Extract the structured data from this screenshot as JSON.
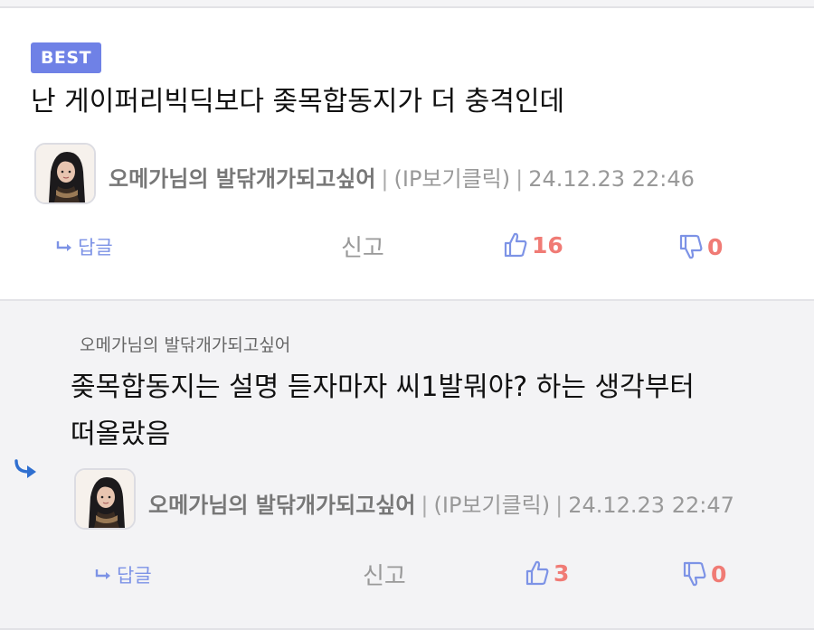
{
  "best_comment": {
    "badge": "BEST",
    "text": "난 게이퍼리빅딕보다 좆목합동지가 더 충격인데",
    "author": "오메가님의 발닦개가되고싶어",
    "ip_label": "(IP보기클릭)",
    "timestamp": "24.12.23 22:46",
    "reply_label": "답글",
    "report_label": "신고",
    "likes": "16",
    "dislikes": "0"
  },
  "reply_comment": {
    "reply_to": "오메가님의 발닦개가되고싶어",
    "text_line1": "좆목합동지는 설명 듣자마자 씨1발뭐야? 하는 생각부터",
    "text_line2": "떠올랐음",
    "author": "오메가님의 발닦개가되고싶어",
    "ip_label": "(IP보기클릭)",
    "timestamp": "24.12.23 22:47",
    "reply_label": "답글",
    "report_label": "신고",
    "likes": "3",
    "dislikes": "0"
  },
  "separator": "|",
  "colors": {
    "badge": "#6f81e6",
    "count": "#f07b75",
    "icon": "#7d93e6",
    "reply_bg": "#f3f3f5"
  }
}
